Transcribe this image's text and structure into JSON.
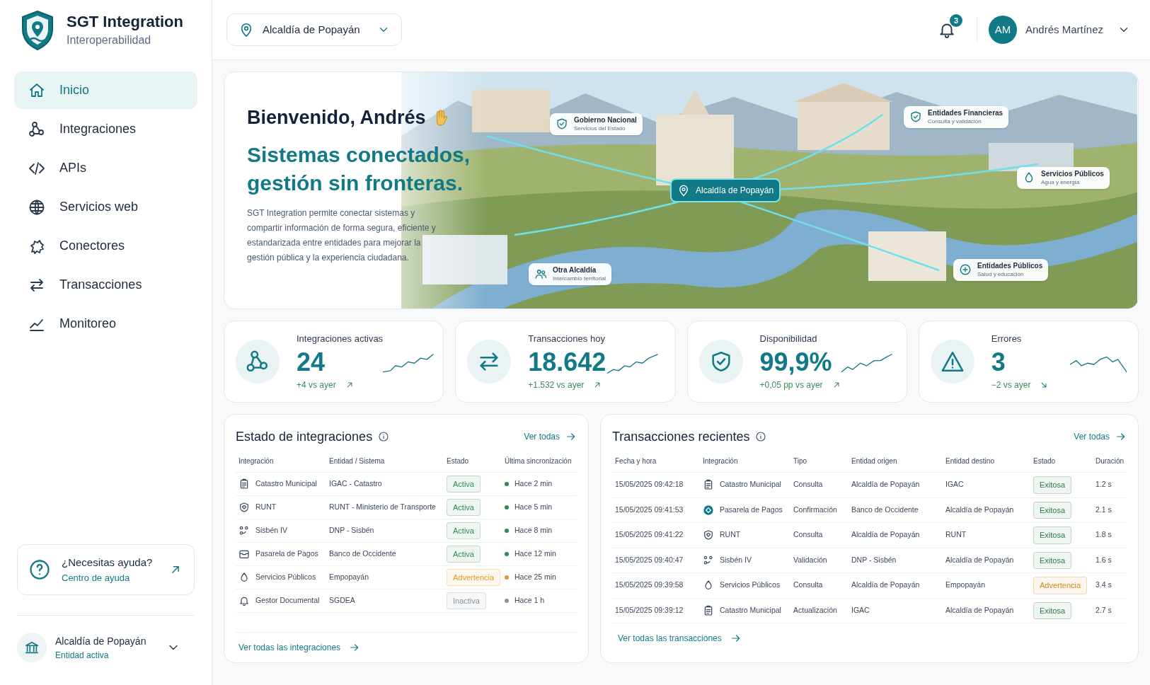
{
  "brand": {
    "title": "SGT Integration",
    "subtitle": "Interoperabilidad"
  },
  "sidebar": {
    "items": [
      {
        "label": "Inicio",
        "selected": true
      },
      {
        "label": "Integraciones",
        "selected": false
      },
      {
        "label": "APIs",
        "selected": false
      },
      {
        "label": "Servicios web",
        "selected": false
      },
      {
        "label": "Conectores",
        "selected": false
      },
      {
        "label": "Transacciones",
        "selected": false
      },
      {
        "label": "Monitoreo",
        "selected": false
      }
    ],
    "help": {
      "title": "¿Necesitas ayuda?",
      "link": "Centro de ayuda"
    },
    "entity": {
      "name": "Alcaldía de Popayán",
      "caption": "Entidad activa"
    }
  },
  "topbar": {
    "entity_selector": "Alcaldía de Popayán",
    "notifications": "3",
    "user": {
      "initials": "AM",
      "name": "Andrés Martínez"
    }
  },
  "hero": {
    "greeting": "Bienvenido, Andrés",
    "headline": "Sistemas conectados, gestión sin fronteras.",
    "description": "SGT Integration permite conectar sistemas y compartir información de forma segura, eficiente y estandarizada entre entidades para mejorar la gestión pública y la experiencia ciudadana.",
    "map_center": "Alcaldía de Popayán",
    "map_labels": [
      {
        "title": "Gobierno Nacional",
        "subtitle": "Servicios del Estado"
      },
      {
        "title": "Entidades Financieras",
        "subtitle": "Consulta y validación"
      },
      {
        "title": "Servicios Públicos",
        "subtitle": "Agua y energía"
      },
      {
        "title": "Entidades Públicos",
        "subtitle": "Salud y educación"
      },
      {
        "title": "Otra Alcaldía",
        "subtitle": "Intercambio territorial"
      }
    ]
  },
  "kpis": [
    {
      "label": "Integraciones activas",
      "value": "24",
      "delta": "+4 vs ayer",
      "rising": true
    },
    {
      "label": "Transacciones hoy",
      "value": "18.642",
      "delta": "+1.532 vs ayer",
      "rising": true
    },
    {
      "label": "Disponibilidad",
      "value": "99,9%",
      "delta": "+0,05 pp vs ayer",
      "rising": true
    },
    {
      "label": "Errores",
      "value": "3",
      "delta": "−2 vs ayer",
      "rising": false
    }
  ],
  "integrations": {
    "title": "Estado de integraciones",
    "view_all": "Ver todas",
    "columns": [
      "Integración",
      "Entidad / Sistema",
      "Estado",
      "Última sincronización"
    ],
    "rows": [
      {
        "name": "Catastro Municipal",
        "entity": "IGAC - Catastro",
        "status": "Activa",
        "color": "#2f8a55",
        "sync": "Hace 2 min"
      },
      {
        "name": "RUNT",
        "entity": "RUNT - Ministerio de Transporte",
        "status": "Activa",
        "color": "#2f8a55",
        "sync": "Hace 5 min"
      },
      {
        "name": "Sisbén IV",
        "entity": "DNP - Sisbén",
        "status": "Activa",
        "color": "#2f8a55",
        "sync": "Hace 8 min"
      },
      {
        "name": "Pasarela de Pagos",
        "entity": "Banco de Occidente",
        "status": "Activa",
        "color": "#2f8a55",
        "sync": "Hace 12 min"
      },
      {
        "name": "Servicios Públicos",
        "entity": "Empopayán",
        "status": "Advertencia",
        "color": "#e39a24",
        "sync": "Hace 25 min"
      },
      {
        "name": "Gestor Documental",
        "entity": "SGDEA",
        "status": "Inactiva",
        "color": "#8a93a0",
        "sync": "Hace 1 h"
      }
    ],
    "footer_link": "Ver todas las integraciones"
  },
  "transactions": {
    "title": "Transacciones recientes",
    "view_all": "Ver todas",
    "columns": [
      "Fecha y hora",
      "Integración",
      "Tipo",
      "Entidad origen",
      "Entidad destino",
      "Estado",
      "Duración"
    ],
    "rows": [
      {
        "datetime": "15/05/2025 09:42:18",
        "integration": "Catastro Municipal",
        "type": "Consulta",
        "origin": "Alcaldía de Popayán",
        "destination": "IGAC",
        "status": "Exitosa",
        "color": "#2f7a4a",
        "duration": "1.2 s"
      },
      {
        "datetime": "15/05/2025 09:41:53",
        "integration": "Pasarela de Pagos",
        "type": "Confirmación",
        "origin": "Banco de Occidente",
        "destination": "Alcaldía de Popayán",
        "status": "Exitosa",
        "color": "#2f7a4a",
        "duration": "2.1 s"
      },
      {
        "datetime": "15/05/2025 09:41:22",
        "integration": "RUNT",
        "type": "Consulta",
        "origin": "Alcaldía de Popayán",
        "destination": "RUNT",
        "status": "Exitosa",
        "color": "#2f7a4a",
        "duration": "1.8 s"
      },
      {
        "datetime": "15/05/2025 09:40:47",
        "integration": "Sisbén IV",
        "type": "Validación",
        "origin": "DNP - Sisbén",
        "destination": "Alcaldía de Popayán",
        "status": "Exitosa",
        "color": "#2f7a4a",
        "duration": "1.6 s"
      },
      {
        "datetime": "15/05/2025 09:39:58",
        "integration": "Servicios Públicos",
        "type": "Consulta",
        "origin": "Alcaldía de Popayán",
        "destination": "Empopayán",
        "status": "Advertencia",
        "color": "#d08a1b",
        "duration": "3.4 s"
      },
      {
        "datetime": "15/05/2025 09:39:12",
        "integration": "Catastro Municipal",
        "type": "Actualización",
        "origin": "IGAC",
        "destination": "Alcaldía de Popayán",
        "status": "Exitosa",
        "color": "#2f7a4a",
        "duration": "2.7 s"
      }
    ],
    "footer_link": "Ver todas las transacciones"
  }
}
